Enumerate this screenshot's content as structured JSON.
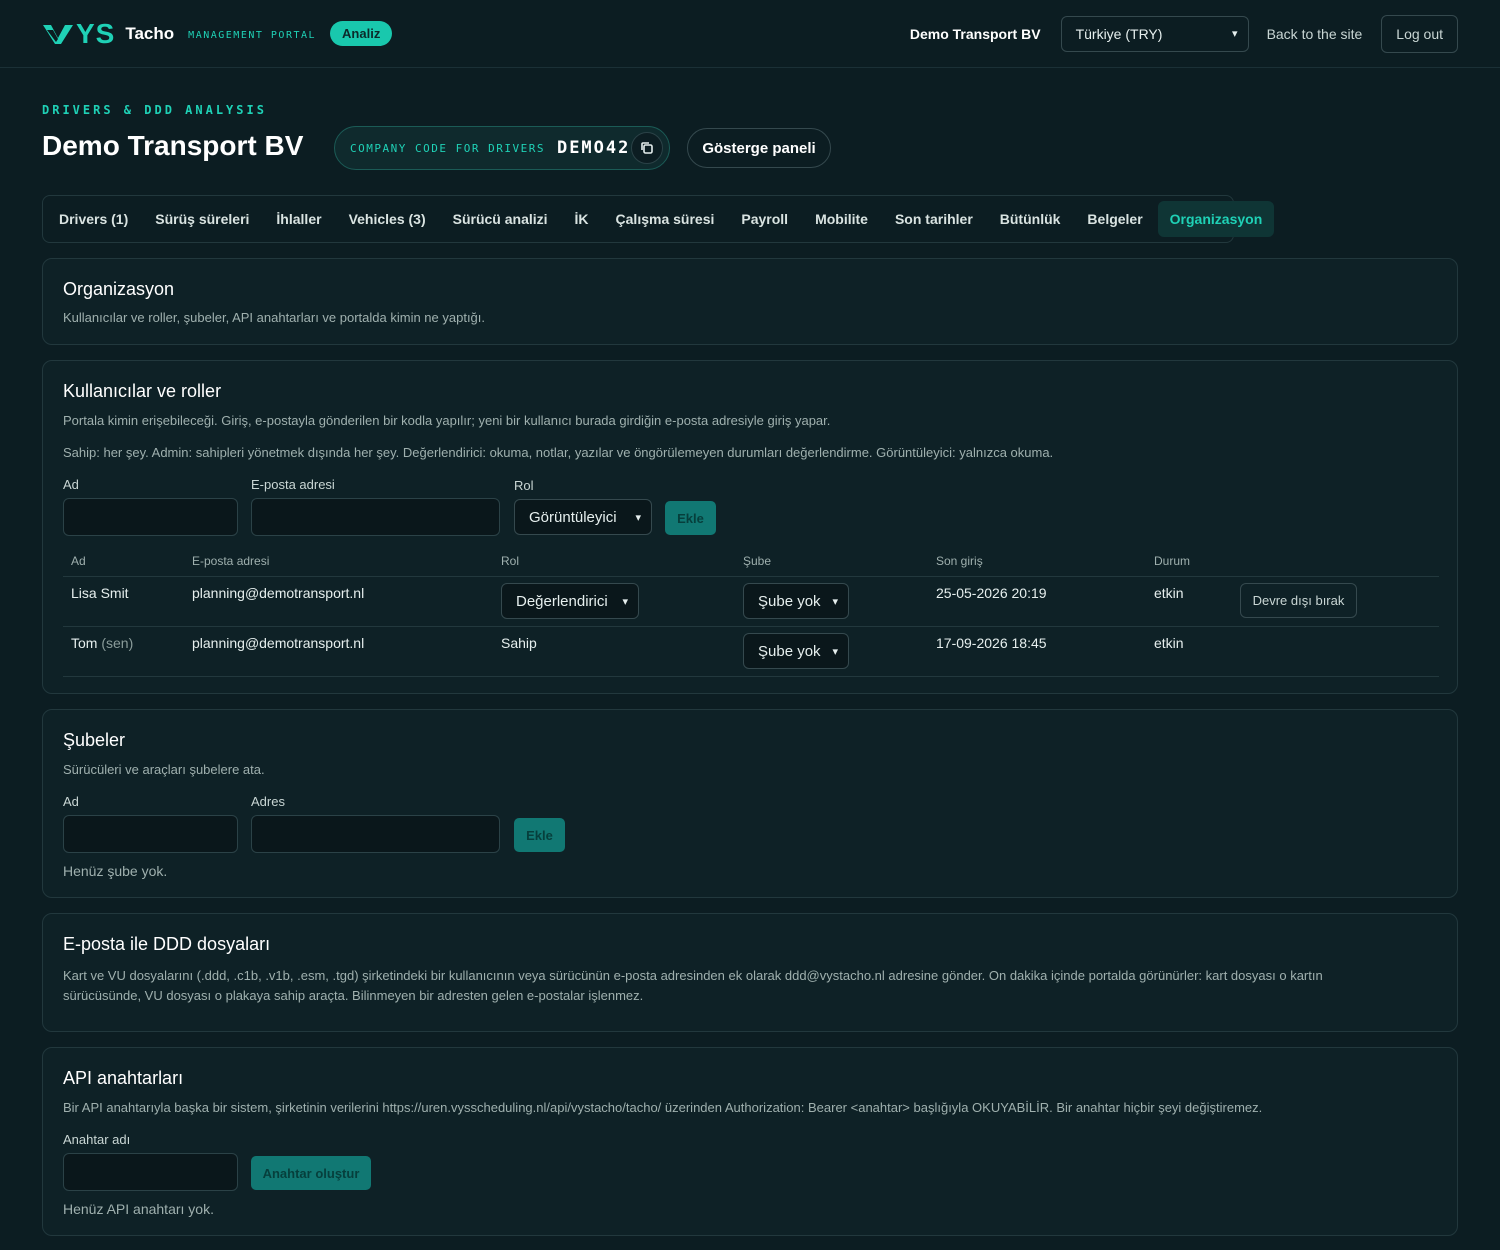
{
  "header": {
    "logo_text": "YS",
    "brand": "Tacho",
    "brand_sub": "MANAGEMENT PORTAL",
    "badge": "Analiz",
    "company": "Demo Transport BV",
    "country_select": "Türkiye (TRY)",
    "back_link": "Back to the site",
    "logout": "Log out"
  },
  "page": {
    "eyebrow": "DRIVERS & DDD ANALYSIS",
    "title": "Demo Transport BV",
    "code_label": "COMPANY CODE FOR DRIVERS",
    "code_value": "DEMO42",
    "dashboard_button": "Gösterge paneli"
  },
  "tabs": [
    {
      "label": "Drivers (1)"
    },
    {
      "label": "Sürüş süreleri"
    },
    {
      "label": "İhlaller"
    },
    {
      "label": "Vehicles (3)"
    },
    {
      "label": "Sürücü analizi"
    },
    {
      "label": "İK"
    },
    {
      "label": "Çalışma süresi"
    },
    {
      "label": "Payroll"
    },
    {
      "label": "Mobilite"
    },
    {
      "label": "Son tarihler"
    },
    {
      "label": "Bütünlük"
    },
    {
      "label": "Belgeler"
    },
    {
      "label": "Organizasyon",
      "active": true
    }
  ],
  "org": {
    "title": "Organizasyon",
    "desc": "Kullanıcılar ve roller, şubeler, API anahtarları ve portalda kimin ne yaptığı."
  },
  "users": {
    "title": "Kullanıcılar ve roller",
    "desc1": "Portala kimin erişebileceği. Giriş, e-postayla gönderilen bir kodla yapılır; yeni bir kullanıcı burada girdiğin e-posta adresiyle giriş yapar.",
    "desc2": "Sahip: her şey. Admin: sahipleri yönetmek dışında her şey. Değerlendirici: okuma, notlar, yazılar ve öngörülemeyen durumları değerlendirme. Görüntüleyici: yalnızca okuma.",
    "form": {
      "name_label": "Ad",
      "email_label": "E-posta adresi",
      "role_label": "Rol",
      "role_value": "Görüntüleyici",
      "add_button": "Ekle"
    },
    "columns": [
      "Ad",
      "E-posta adresi",
      "Rol",
      "Şube",
      "Son giriş",
      "Durum"
    ],
    "rows": [
      {
        "name": "Lisa Smit",
        "suffix": "",
        "email": "planning@demotransport.nl",
        "role": "Değerlendirici",
        "branch": "Şube yok",
        "last_login": "25-05-2026 20:19",
        "status": "etkin",
        "action": "Devre dışı bırak"
      },
      {
        "name": "Tom",
        "suffix": "(sen)",
        "email": "planning@demotransport.nl",
        "role": "Sahip",
        "branch": "Şube yok",
        "last_login": "17-09-2026 18:45",
        "status": "etkin",
        "action": ""
      }
    ]
  },
  "branches": {
    "title": "Şubeler",
    "desc": "Sürücüleri ve araçları şubelere ata.",
    "name_label": "Ad",
    "address_label": "Adres",
    "add_button": "Ekle",
    "empty": "Henüz şube yok."
  },
  "email_ddd": {
    "title": "E-posta ile DDD dosyaları",
    "desc": "Kart ve VU dosyalarını (.ddd, .c1b, .v1b, .esm, .tgd) şirketindeki bir kullanıcının veya sürücünün e-posta adresinden ek olarak ddd@vystacho.nl adresine gönder. On dakika içinde portalda görünürler: kart dosyası o kartın sürücüsünde, VU dosyası o plakaya sahip araçta. Bilinmeyen bir adresten gelen e-postalar işlenmez."
  },
  "api": {
    "title": "API anahtarları",
    "desc": "Bir API anahtarıyla başka bir sistem, şirketinin verilerini https://uren.vysscheduling.nl/api/vystacho/tacho/ üzerinden Authorization: Bearer <anahtar> başlığıyla OKUYABİLİR. Bir anahtar hiçbir şeyi değiştiremez.",
    "key_label": "Anahtar adı",
    "create_button": "Anahtar oluştur",
    "empty": "Henüz API anahtarı yok."
  },
  "colors": {
    "accent": "#1fd1b6",
    "background": "#0c1d22",
    "card": "#0e2126"
  }
}
